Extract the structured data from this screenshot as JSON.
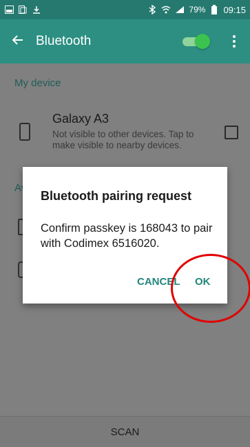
{
  "status_bar": {
    "battery_percent": "79%",
    "time": "09:15",
    "icons": [
      "gallery-icon",
      "screen-icon",
      "download-icon",
      "bluetooth-icon",
      "wifi-icon",
      "signal-icon",
      "battery-icon"
    ]
  },
  "action_bar": {
    "title": "Bluetooth",
    "toggle_on": true
  },
  "content": {
    "my_device_header": "My device",
    "device_name": "Galaxy A3",
    "device_subtitle": "Not visible to other devices. Tap to make visible to nearby devices.",
    "available_header_partial": "Av"
  },
  "dialog": {
    "title": "Bluetooth pairing request",
    "message": "Confirm passkey is 168043 to pair with Codimex 6516020.",
    "cancel_label": "CANCEL",
    "ok_label": "OK"
  },
  "bottom_bar": {
    "scan_label": "SCAN"
  },
  "colors": {
    "accent": "#2c8f82",
    "status_bar": "#25796f",
    "button_text": "#21857b",
    "highlight": "#e00000"
  }
}
